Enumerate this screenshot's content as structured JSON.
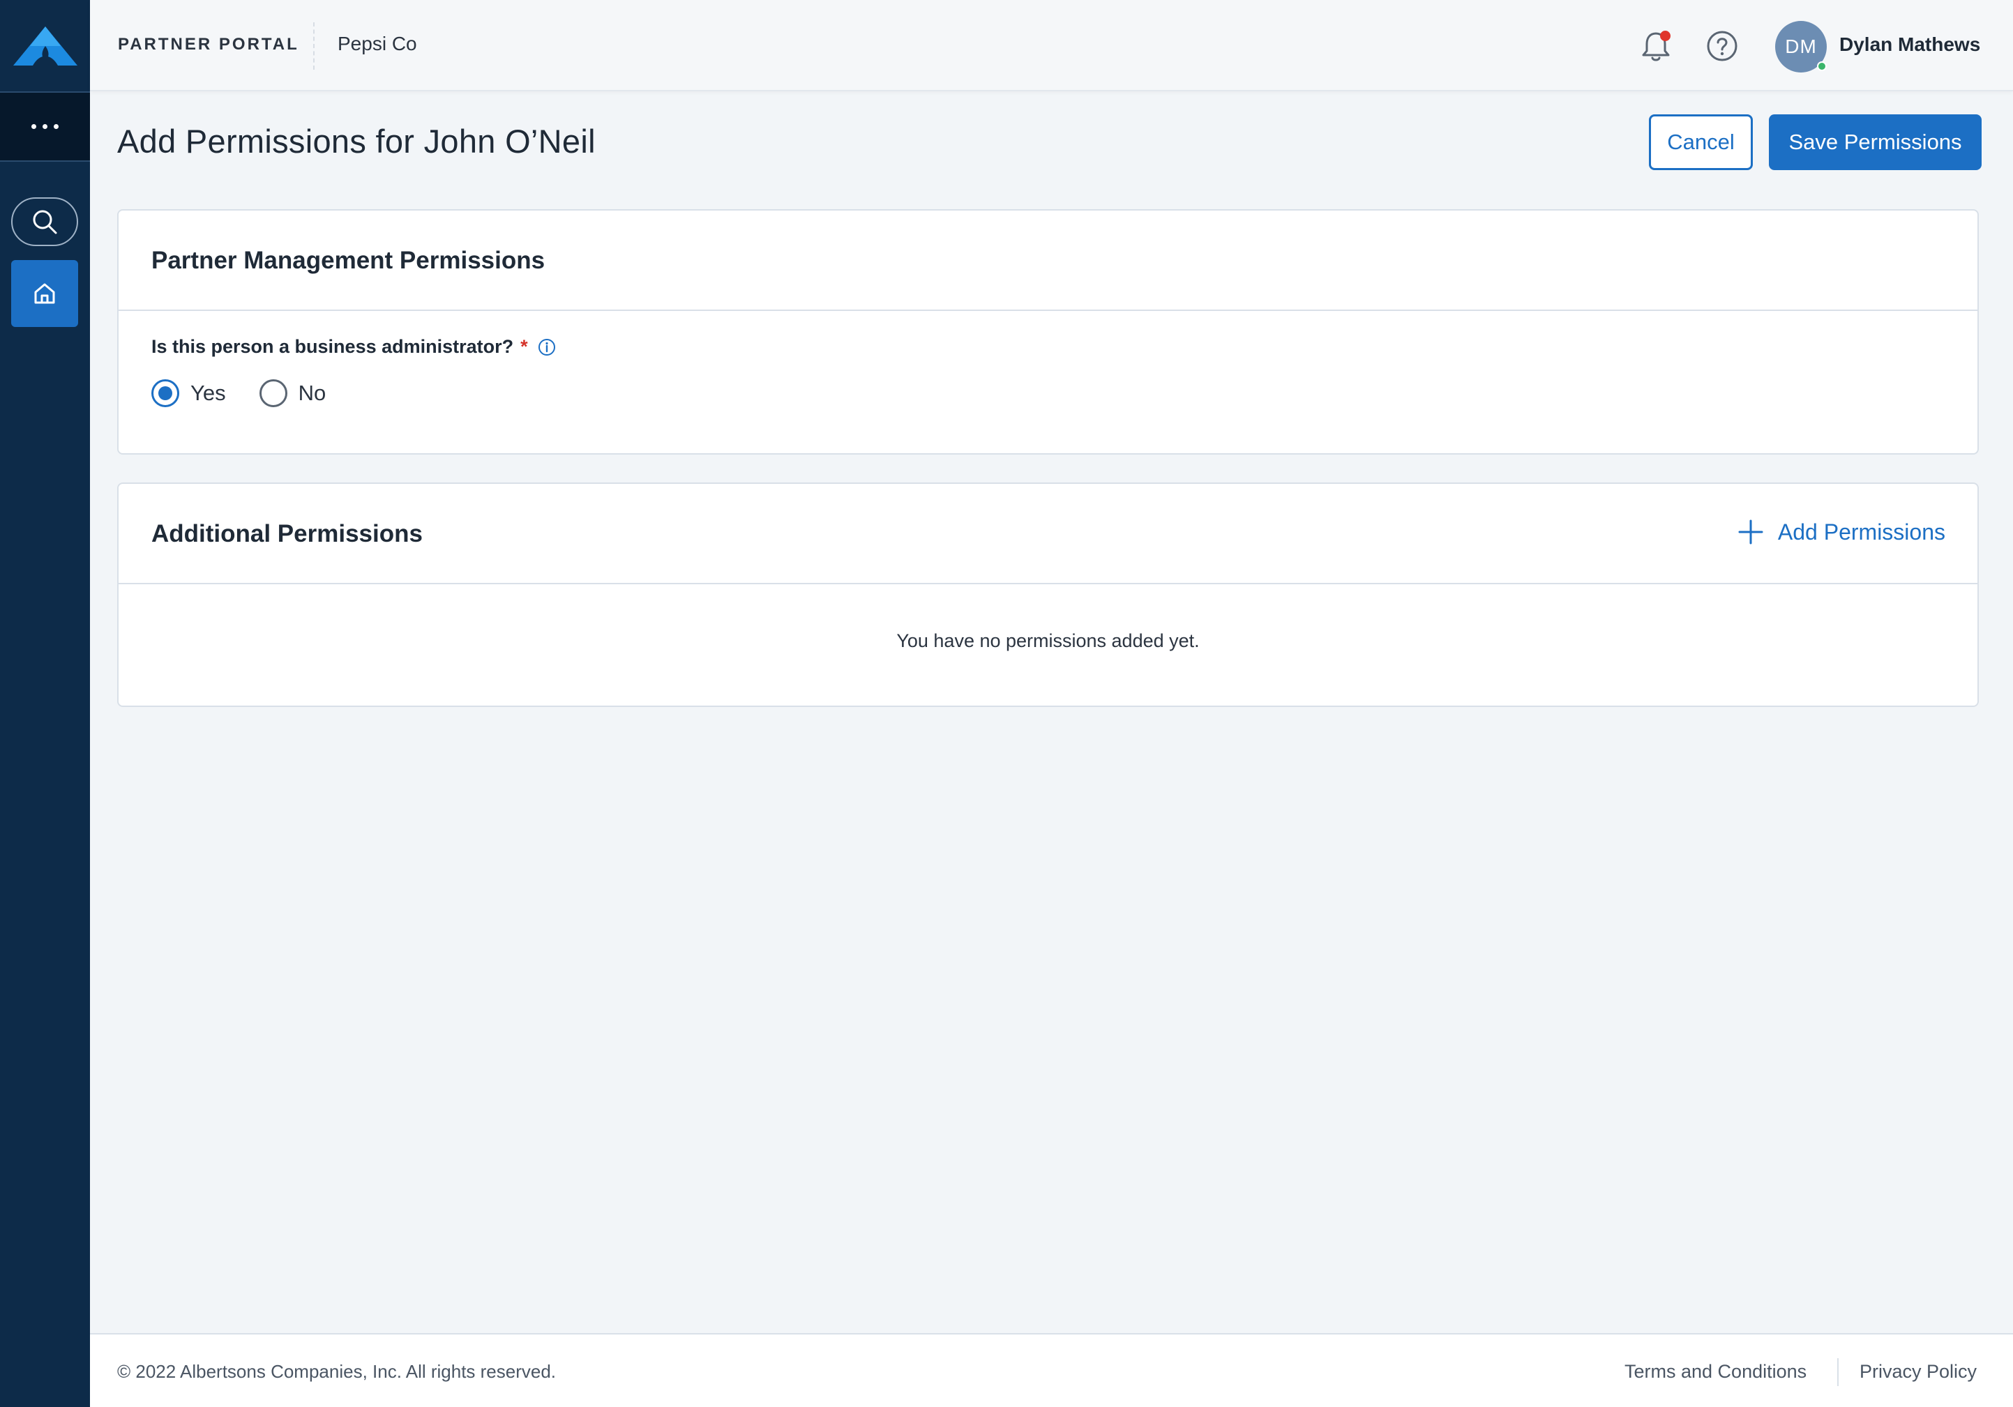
{
  "sidebar": {
    "logo": "albertsons-logo",
    "more_icon": "ellipsis-icon",
    "search_icon": "search-icon",
    "home_icon": "home-icon",
    "active_item": "home"
  },
  "header": {
    "portal_title": "PARTNER PORTAL",
    "organization": "Pepsi Co",
    "notification_icon": "bell-icon",
    "has_unread_notifications": true,
    "help_icon": "help-icon",
    "user": {
      "initials": "DM",
      "name": "Dylan Mathews",
      "status": "online"
    }
  },
  "page": {
    "title": "Add Permissions for John O’Neil",
    "cancel_label": "Cancel",
    "save_label": "Save Permissions"
  },
  "partner_management": {
    "title": "Partner Management Permissions",
    "question": "Is this person a business administrator?",
    "required_mark": "*",
    "info_icon": "info-icon",
    "options": [
      {
        "label": "Yes",
        "selected": true
      },
      {
        "label": "No",
        "selected": false
      }
    ]
  },
  "additional_permissions": {
    "title": "Additional Permissions",
    "add_label": "Add Permissions",
    "add_icon": "plus-icon",
    "empty_message": "You have no permissions added yet."
  },
  "footer": {
    "copyright": "© 2022 Albertsons Companies, Inc. All rights reserved.",
    "terms_label": "Terms and Conditions",
    "privacy_label": "Privacy Policy"
  },
  "colors": {
    "sidebar": "#0d2b49",
    "primary": "#1c6fc4",
    "background": "#f2f5f8",
    "notification": "#e0352b",
    "online": "#3bb56b"
  }
}
